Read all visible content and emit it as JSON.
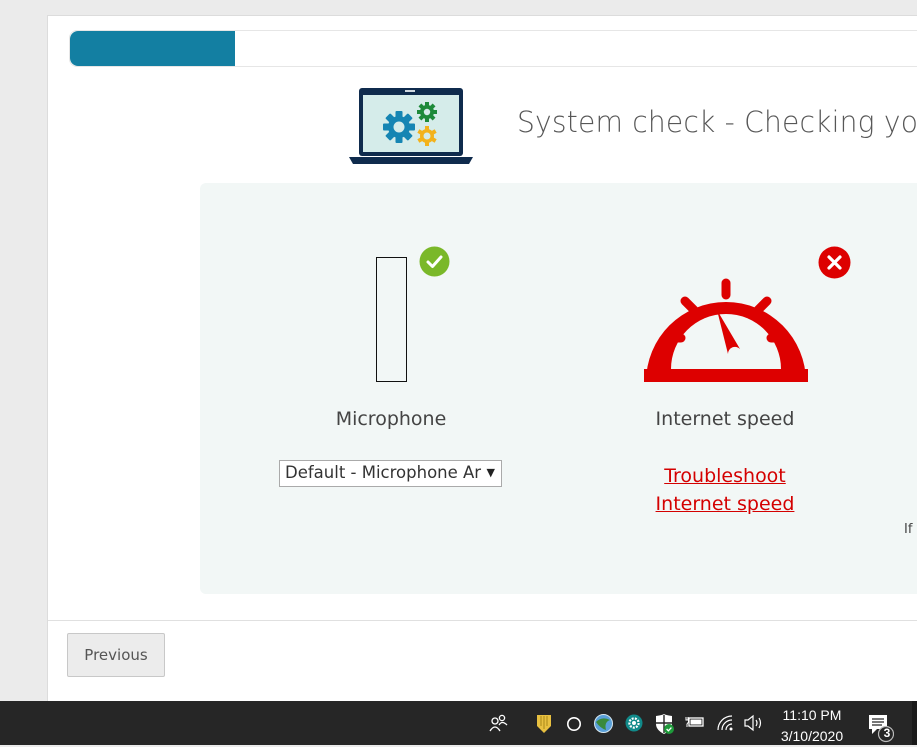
{
  "progress": {
    "completed_fraction": 0.2
  },
  "header": {
    "title": "System check - Checking your"
  },
  "checks": [
    {
      "name": "Microphone",
      "status": "ok",
      "device_select": {
        "selected": "Default - Microphone Ar",
        "arrow": "▼"
      }
    },
    {
      "name": "Internet speed",
      "status": "error",
      "link_line1": "Troubleshoot",
      "link_line2": "Internet speed"
    }
  ],
  "partial_text": "If y",
  "footer": {
    "previous_label": "Previous"
  },
  "colors": {
    "accent": "#137fa2",
    "ok": "#7ab829",
    "error": "#dd0000",
    "panel": "#f2f7f6"
  },
  "taskbar": {
    "tray_icons": [
      "people-icon",
      "shield-icon",
      "cortana-circle-icon",
      "globe-app-icon",
      "gear-app-icon",
      "defender-shield-icon",
      "battery-icon",
      "wifi-icon",
      "volume-icon"
    ],
    "time": "11:10 PM",
    "date": "3/10/2020",
    "notification_count": "3"
  }
}
